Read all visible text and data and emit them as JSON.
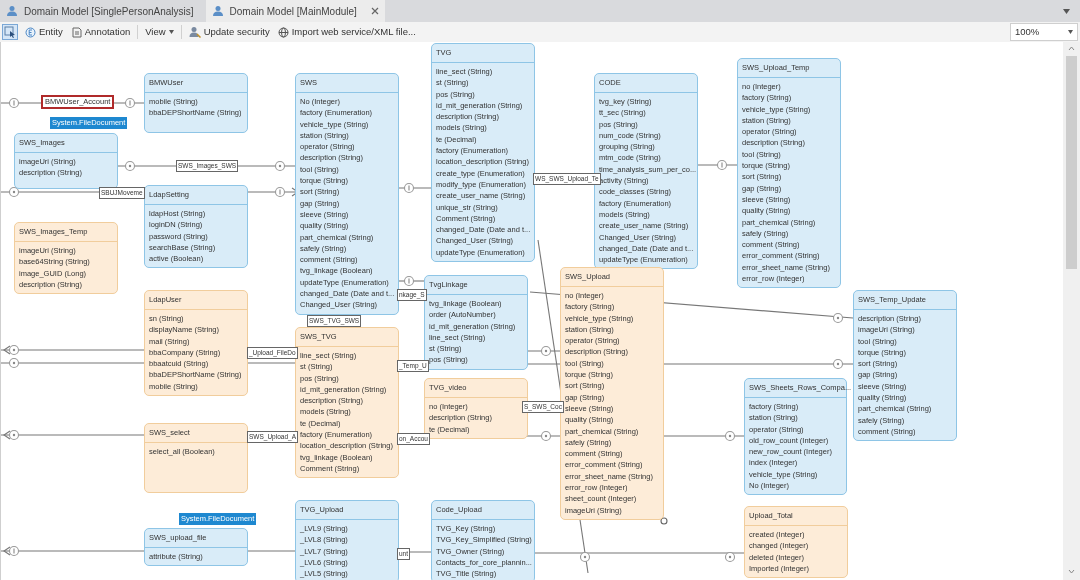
{
  "tabs": [
    {
      "label": "Domain Model [SinglePersonAnalysis]",
      "selected": false
    },
    {
      "label": "Domain Model [MainModule]",
      "selected": true
    }
  ],
  "toolbar": [
    {
      "kind": "tool",
      "selected": true
    },
    {
      "kind": "button",
      "label": "Entity",
      "selected": false
    },
    {
      "kind": "button",
      "label": "Annotation",
      "selected": false
    },
    {
      "kind": "menu",
      "label": "View",
      "selected": false
    },
    {
      "kind": "button",
      "label": "Update security",
      "selected": false
    },
    {
      "kind": "button",
      "label": "Import web service/XML file...",
      "selected": false
    }
  ],
  "zoom": {
    "value": "100%"
  },
  "entities": [
    {
      "name": "BMWUser",
      "persistable": true,
      "attributes": [
        "mobile (String)",
        "bbaDEPShortName (String)"
      ]
    },
    {
      "name": "SWS",
      "persistable": true,
      "attributes": [
        "No (Integer)",
        "factory (Enumeration)",
        "vehicle_type (String)",
        "station (String)",
        "operator (String)",
        "description (String)",
        "tool (String)",
        "torque (String)",
        "sort (String)",
        "gap (String)",
        "sleeve (String)",
        "quality (String)",
        "part_chemical (String)",
        "safely (String)",
        "comment (String)",
        "tvg_linkage (Boolean)",
        "updateType (Enumeration)",
        "changed_Date (Date and t...",
        "Changed_User (String)"
      ]
    },
    {
      "name": "TVG",
      "persistable": true,
      "attributes": [
        "line_sect (String)",
        "st (String)",
        "pos (String)",
        "id_mit_generation (String)",
        "description (String)",
        "models (String)",
        "te (Decimal)",
        "factory (Enumeration)",
        "location_description (String)",
        "create_type (Enumeration)",
        "modify_type (Enumeration)",
        "create_user_name (String)",
        "unique_str (String)",
        "Comment (String)",
        "changed_Date (Date and t...",
        "Changed_User (String)",
        "updateType (Enumeration)"
      ]
    },
    {
      "name": "CODE",
      "persistable": true,
      "attributes": [
        "tvg_key (String)",
        "tt_sec (String)",
        "pos (String)",
        "num_code (String)",
        "grouping (String)",
        "mtm_code (String)",
        "time_analysis_sum_per_co...",
        "activity (String)",
        "code_classes (String)",
        "factory (Enumeration)",
        "models (String)",
        "create_user_name (String)",
        "Changed_User (String)",
        "changed_Date (Date and t...",
        "updateType (Enumeration)"
      ]
    },
    {
      "name": "SWS_Upload_Temp",
      "persistable": true,
      "attributes": [
        "no (Integer)",
        "factory (String)",
        "vehicle_type (String)",
        "station (String)",
        "operator (String)",
        "description (String)",
        "tool (String)",
        "torque (String)",
        "sort (String)",
        "gap (String)",
        "sleeve (String)",
        "quality (String)",
        "part_chemical (String)",
        "safely (String)",
        "comment (String)",
        "error_comment (String)",
        "error_sheet_name (String)",
        "error_row (Integer)"
      ]
    },
    {
      "name": "SWS_Images",
      "persistable": true,
      "attributes": [
        "imageUri (String)",
        "description (String)"
      ]
    },
    {
      "name": "LdapSetting",
      "persistable": true,
      "attributes": [
        "ldapHost (String)",
        "loginDN (String)",
        "password (String)",
        "searchBase (String)",
        "active (Boolean)"
      ]
    },
    {
      "name": "SWS_Images_Temp",
      "persistable": false,
      "attributes": [
        "imageUri (String)",
        "base64String (String)",
        "image_GUID (Long)",
        "description (String)"
      ]
    },
    {
      "name": "LdapUser",
      "persistable": false,
      "attributes": [
        "sn (String)",
        "displayName (String)",
        "mail (String)",
        "bbaCompany (String)",
        "bbaatcuid (String)",
        "bbaDEPShortName (String)",
        "mobile (String)"
      ]
    },
    {
      "name": "TvgLinkage",
      "persistable": true,
      "attributes": [
        "tvg_linkage (Boolean)",
        "order (AutoNumber)",
        "id_mit_generation (String)",
        "line_sect (String)",
        "st (String)",
        "pos (String)"
      ]
    },
    {
      "name": "SWS_Upload",
      "persistable": false,
      "attributes": [
        "no (Integer)",
        "factory (String)",
        "vehicle_type (String)",
        "station (String)",
        "operator (String)",
        "description (String)",
        "tool (String)",
        "torque (String)",
        "sort (String)",
        "gap (String)",
        "sleeve (String)",
        "quality (String)",
        "part_chemical (String)",
        "safely (String)",
        "comment (String)",
        "error_comment (String)",
        "error_sheet_name (String)",
        "error_row (Integer)",
        "sheet_count (Integer)",
        "imageUri (String)"
      ]
    },
    {
      "name": "SWS_Temp_Update",
      "persistable": true,
      "attributes": [
        "description (String)",
        "imageUri (String)",
        "tool (String)",
        "torque (String)",
        "sort (String)",
        "gap (String)",
        "sleeve (String)",
        "quality (String)",
        "part_chemical (String)",
        "safely (String)",
        "comment (String)"
      ]
    },
    {
      "name": "SWS_TVG",
      "persistable": false,
      "attributes": [
        "line_sect (String)",
        "st (String)",
        "pos (String)",
        "id_mit_generation (String)",
        "description (String)",
        "models (String)",
        "te (Decimal)",
        "factory (Enumeration)",
        "location_description (String)",
        "tvg_linkage (Boolean)",
        "Comment (String)"
      ]
    },
    {
      "name": "TVG_video",
      "persistable": false,
      "attributes": [
        "no (Integer)",
        "description (String)",
        "te (Decimal)"
      ]
    },
    {
      "name": "SWS_Sheets_Rows_Compa...",
      "persistable": true,
      "attributes": [
        "factory (String)",
        "station (String)",
        "operator (String)",
        "old_row_count (Integer)",
        "new_row_count (Integer)",
        "index (Integer)",
        "vehicle_type (String)",
        "No (Integer)"
      ]
    },
    {
      "name": "SWS_select",
      "persistable": false,
      "attributes": [
        "select_all (Boolean)"
      ]
    },
    {
      "name": "TVG_Upload",
      "persistable": true,
      "attributes": [
        "_LVL9 (String)",
        "_LVL8 (String)",
        "_LVL7 (String)",
        "_LVL6 (String)",
        "_LVL5 (String)"
      ]
    },
    {
      "name": "Code_Upload",
      "persistable": true,
      "attributes": [
        "TVG_Key (String)",
        "TVG_Key_Simplified (String)",
        "TVG_Owner (String)",
        "Contacts_for_core_plannin...",
        "TVG_Title (String)"
      ]
    },
    {
      "name": "SWS_upload_file",
      "persistable": true,
      "attributes": [
        "attribute (String)"
      ]
    },
    {
      "name": "Upload_Total",
      "persistable": false,
      "attributes": [
        "created (Integer)",
        "changed (Integer)",
        "deleted (Integer)",
        "Imported (Integer)"
      ]
    }
  ],
  "labels": [
    {
      "kind": "association",
      "text": "BMWUser_Account",
      "selected": true
    },
    {
      "kind": "generalization",
      "text": "System.FileDocument"
    },
    {
      "kind": "association",
      "text": "SWS_Images_SWS",
      "selected": false
    },
    {
      "kind": "association",
      "text": "SBUJMoveme",
      "selected": false
    },
    {
      "kind": "association",
      "text": "WS_SWS_Upload_Te",
      "selected": false
    },
    {
      "kind": "association",
      "text": "nkage_S",
      "selected": false
    },
    {
      "kind": "association",
      "text": "SWS_TVG_SWS",
      "selected": false
    },
    {
      "kind": "association",
      "text": "_Upload_FileDo",
      "selected": false
    },
    {
      "kind": "association",
      "text": "_Temp_U",
      "selected": false
    },
    {
      "kind": "association",
      "text": "S_SWS_Coc",
      "selected": false
    },
    {
      "kind": "association",
      "text": "SWS_Upload_A",
      "selected": false
    },
    {
      "kind": "association",
      "text": "on_Accou",
      "selected": false
    },
    {
      "kind": "generalization",
      "text": "System.FileDocument"
    },
    {
      "kind": "association",
      "text": "unt",
      "selected": false
    }
  ]
}
